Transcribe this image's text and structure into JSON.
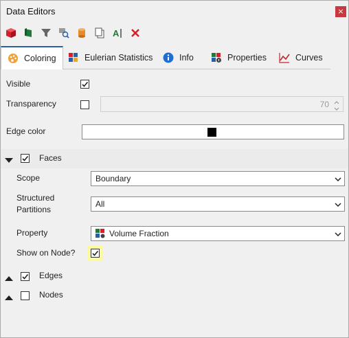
{
  "window": {
    "title": "Data Editors",
    "close_glyph": "×"
  },
  "toolbar": {
    "icons": [
      "red-cube-icon",
      "green-flag-icon",
      "filter-icon",
      "find-icon",
      "cylinder-icon",
      "copy-icon",
      "text-cursor-icon",
      "delete-icon"
    ]
  },
  "tabs": [
    {
      "label": "Coloring",
      "icon": "palette-icon",
      "active": true
    },
    {
      "label": "Eulerian Statistics",
      "icon": "cubes-icon",
      "active": false
    },
    {
      "label": "Info",
      "icon": "info-icon",
      "active": false
    },
    {
      "label": "Properties",
      "icon": "properties-icon",
      "active": false
    },
    {
      "label": "Curves",
      "icon": "curves-icon",
      "active": false
    }
  ],
  "coloring": {
    "visible_label": "Visible",
    "visible_checked": true,
    "transparency_label": "Transparency",
    "transparency_checked": false,
    "transparency_value": "70",
    "edge_color_label": "Edge color",
    "edge_color": "#000000",
    "faces": {
      "label": "Faces",
      "checked": true,
      "expanded": true,
      "scope_label": "Scope",
      "scope_value": "Boundary",
      "partitions_label_line1": "Structured",
      "partitions_label_line2": "Partitions",
      "partitions_value": "All",
      "property_label": "Property",
      "property_value": "Volume Fraction",
      "show_on_node_label": "Show on Node?",
      "show_on_node_checked": true
    },
    "edges": {
      "label": "Edges",
      "checked": true
    },
    "nodes": {
      "label": "Nodes",
      "checked": false
    }
  },
  "colors": {
    "accent": "#2a5ea8",
    "highlight": "#fbfb9e",
    "close_bg": "#c8383f"
  }
}
